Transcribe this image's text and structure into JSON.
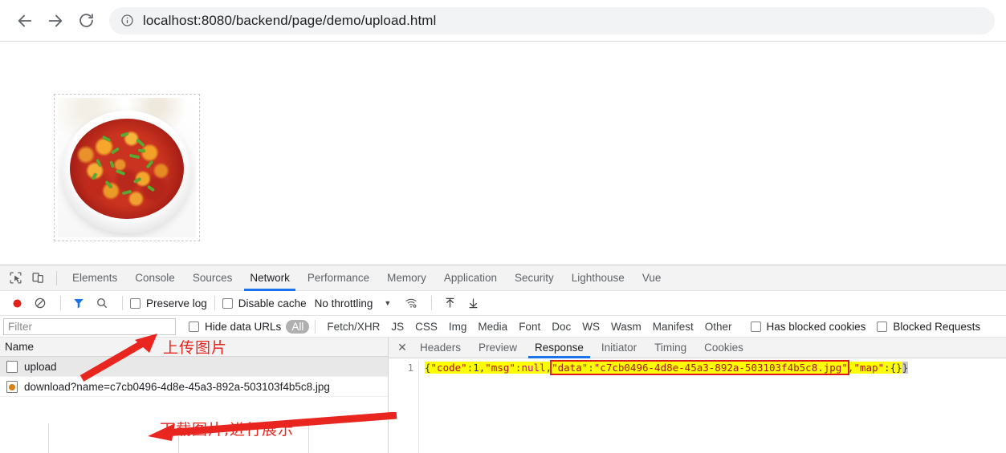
{
  "browser": {
    "back_icon": "arrow-left-icon",
    "forward_icon": "arrow-right-icon",
    "reload_icon": "reload-icon",
    "site_info_icon": "info-circle-icon",
    "url": "localhost:8080/backend/page/demo/upload.html"
  },
  "page": {
    "preview_alt": "uploaded food photo - mapo tofu in white bowl"
  },
  "devtools": {
    "inspect_icon": "inspect-element-icon",
    "device_icon": "device-toolbar-icon",
    "tabs": [
      {
        "label": "Elements",
        "active": false
      },
      {
        "label": "Console",
        "active": false
      },
      {
        "label": "Sources",
        "active": false
      },
      {
        "label": "Network",
        "active": true
      },
      {
        "label": "Performance",
        "active": false
      },
      {
        "label": "Memory",
        "active": false
      },
      {
        "label": "Application",
        "active": false
      },
      {
        "label": "Security",
        "active": false
      },
      {
        "label": "Lighthouse",
        "active": false
      },
      {
        "label": "Vue",
        "active": false
      }
    ],
    "toolbar": {
      "record_icon": "record-circle-icon",
      "clear_icon": "clear-no-entry-icon",
      "filter_icon": "funnel-filter-icon",
      "search_icon": "search-magnifier-icon",
      "preserve_log_label": "Preserve log",
      "disable_cache_label": "Disable cache",
      "throttling_label": "No throttling",
      "throttle_caret": "▼",
      "wifi_icon": "wifi-settings-icon",
      "import_icon": "import-har-up-arrow-icon",
      "export_icon": "export-har-down-arrow-icon"
    },
    "filterbar": {
      "filter_placeholder": "Filter",
      "hide_data_urls_label": "Hide data URLs",
      "types": [
        "All",
        "Fetch/XHR",
        "JS",
        "CSS",
        "Img",
        "Media",
        "Font",
        "Doc",
        "WS",
        "Wasm",
        "Manifest",
        "Other"
      ],
      "selected_type": "All",
      "has_blocked_cookies_label": "Has blocked cookies",
      "blocked_requests_label": "Blocked Requests"
    },
    "requests": {
      "column_header": "Name",
      "rows": [
        {
          "name": "upload",
          "icon": "document-icon",
          "selected": true
        },
        {
          "name": "download?name=c7cb0496-4d8e-45a3-892a-503103f4b5c8.jpg",
          "icon": "image-icon",
          "selected": false
        }
      ]
    },
    "detail": {
      "close_icon": "close-x-icon",
      "tabs": [
        {
          "label": "Headers",
          "active": false
        },
        {
          "label": "Preview",
          "active": false
        },
        {
          "label": "Response",
          "active": true
        },
        {
          "label": "Initiator",
          "active": false
        },
        {
          "label": "Timing",
          "active": false
        },
        {
          "label": "Cookies",
          "active": false
        }
      ],
      "line_number": "1",
      "response_tokens": {
        "open_brace": "{",
        "code_key": "\"code\"",
        "colon1": ":",
        "code_value": "1",
        "comma1": ",",
        "msg_key": "\"msg\"",
        "colon2": ":",
        "msg_value": "null",
        "comma2": ",",
        "data_key": "\"data\"",
        "colon3": ":",
        "data_value": "\"c7cb0496-4d8e-45a3-892a-503103f4b5c8.jpg\"",
        "comma3": ",",
        "map_key": "\"map\"",
        "colon4": ":",
        "map_value": "{}",
        "close_brace": "}"
      },
      "highlight_color": "#ffff00",
      "redbox_color": "#e01b1b"
    }
  },
  "annotations": {
    "accent_color": "#e8251f",
    "upload_note": "上传图片",
    "download_note": "下载图片,进行展示"
  }
}
